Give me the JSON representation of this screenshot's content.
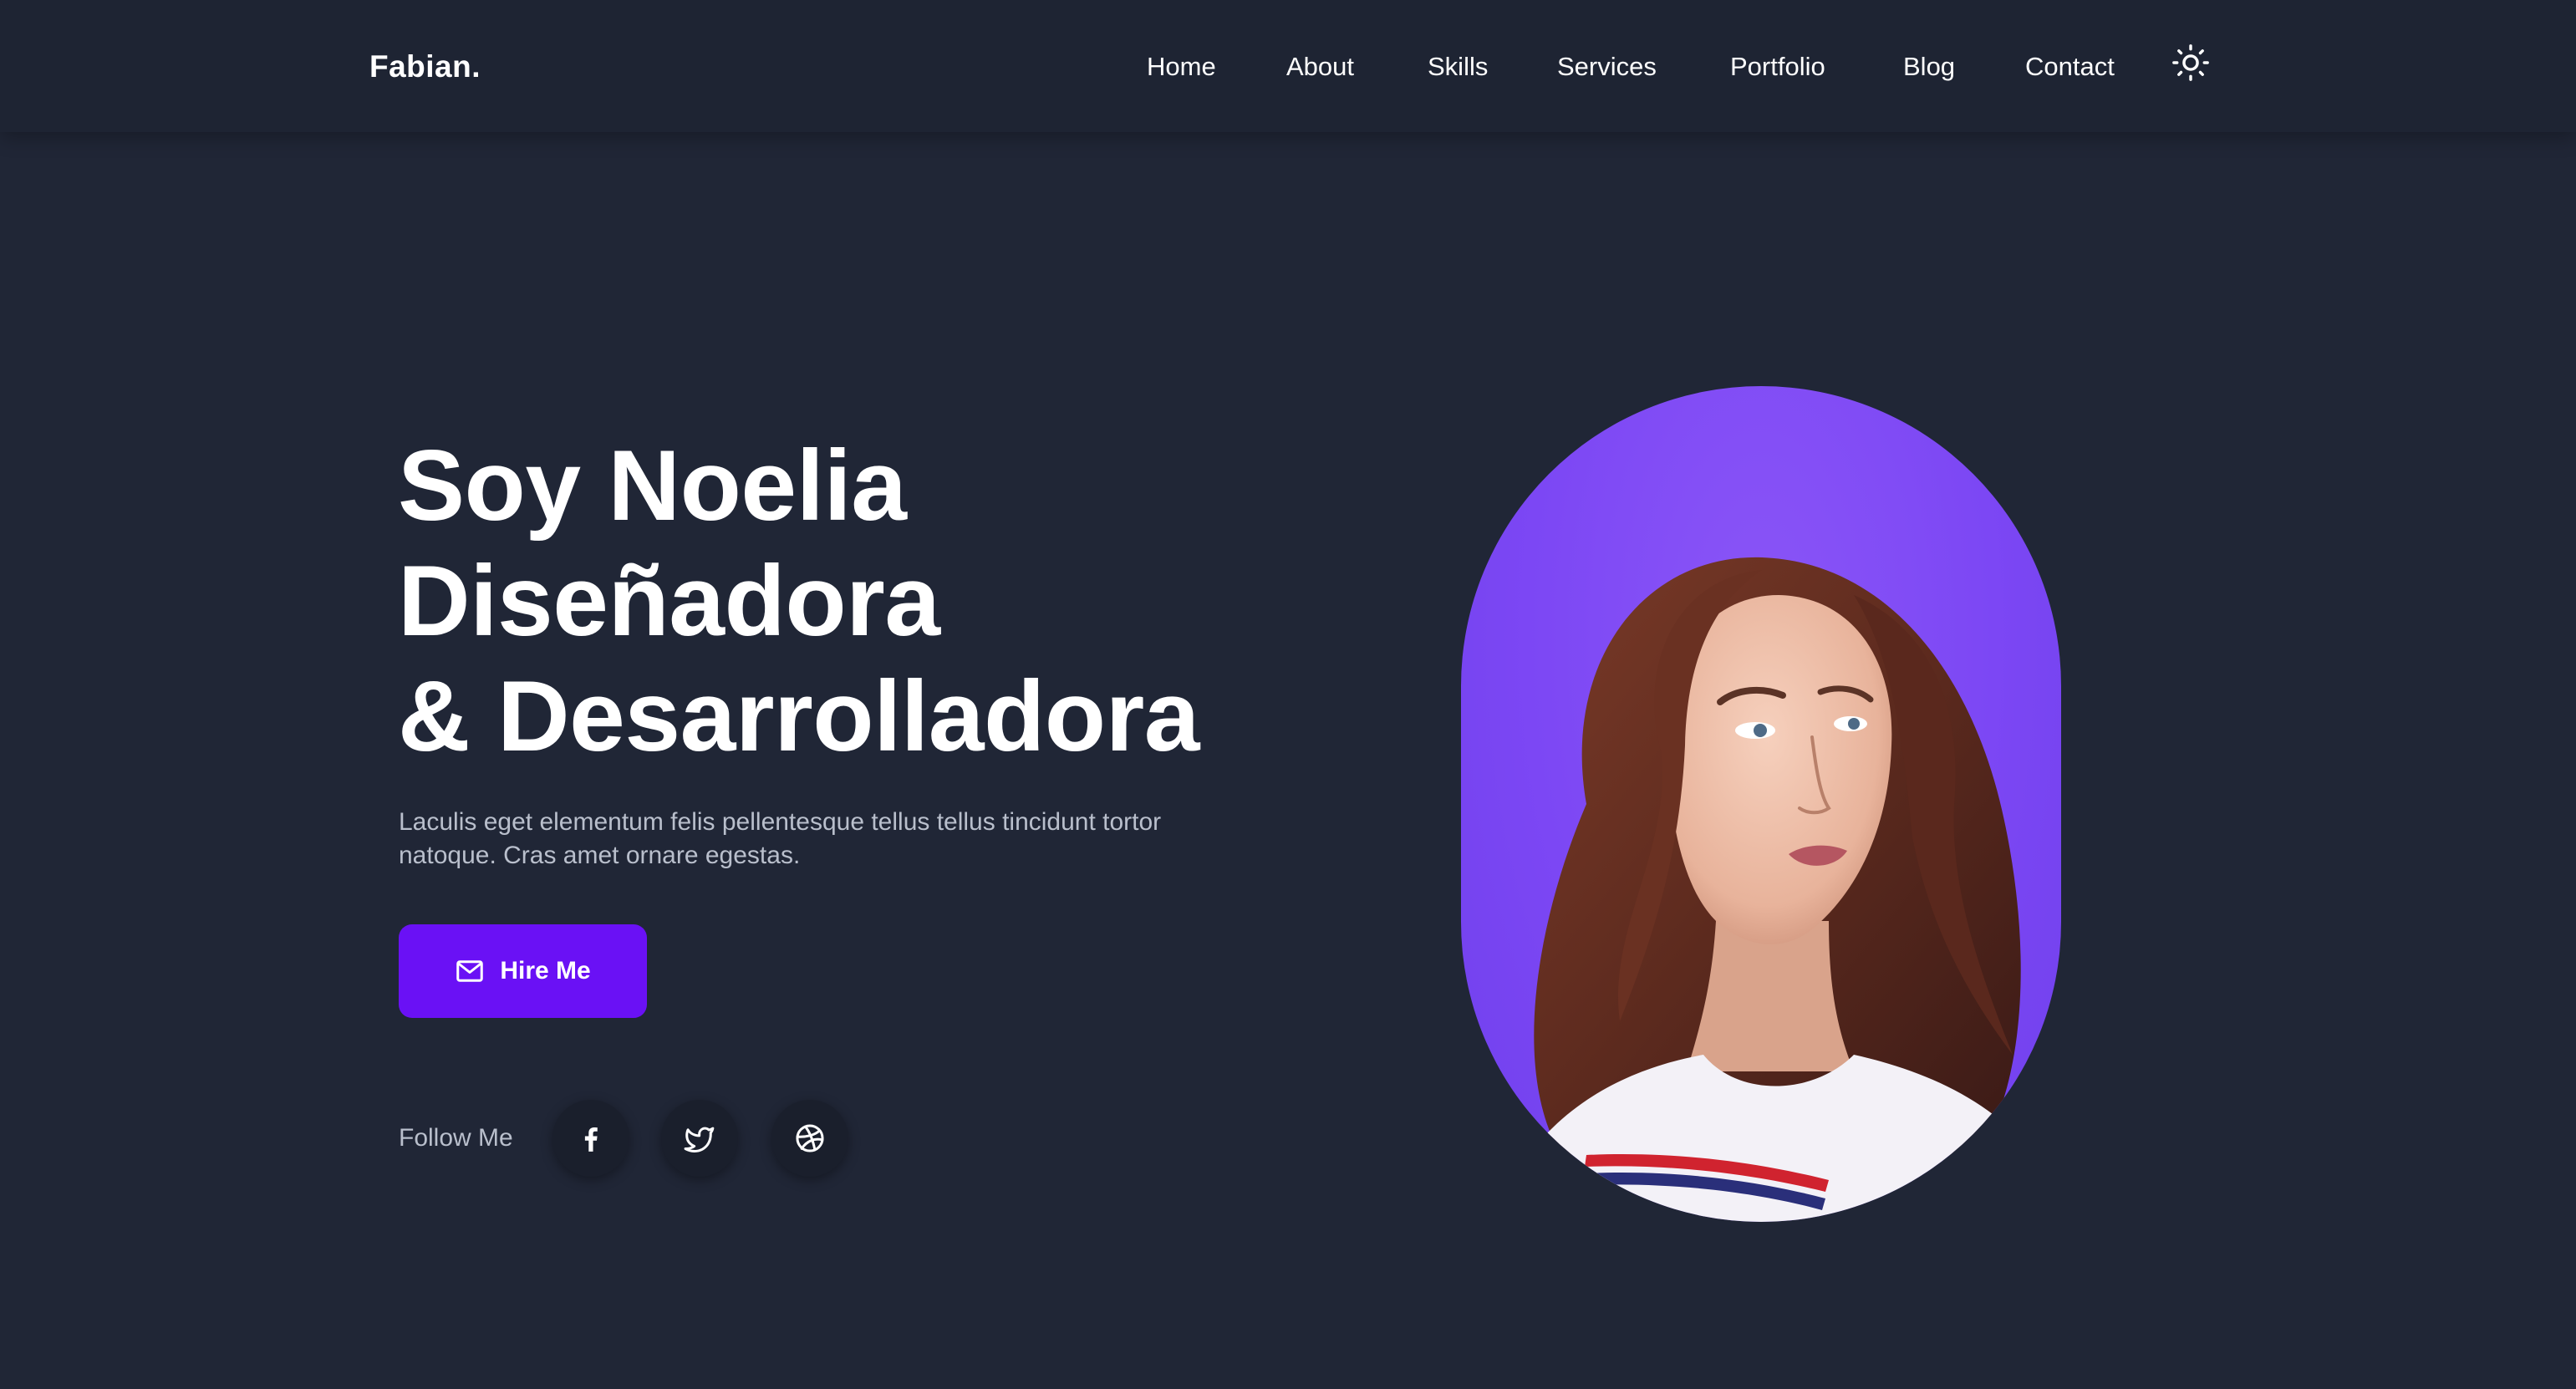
{
  "header": {
    "logo": "Fabian.",
    "nav": [
      "Home",
      "About",
      "Skills",
      "Services",
      "Portfolio",
      "Blog",
      "Contact"
    ],
    "theme_toggle_icon": "sun-icon"
  },
  "hero": {
    "title_line1": "Soy Noelia",
    "title_line2": "Diseñadora",
    "title_line3": "& Desarrolladora",
    "description": "Laculis eget elementum felis pellentesque tellus tellus tincidunt tortor natoque. Cras amet ornare egestas.",
    "hire_button": "Hire Me",
    "hire_button_icon": "mail-icon",
    "follow_label": "Follow Me",
    "socials": [
      "facebook-icon",
      "twitter-icon",
      "dribbble-icon"
    ],
    "portrait_icon": "profile-photo"
  },
  "colors": {
    "background": "#202636",
    "header": "#1e2433",
    "accent": "#6a11f5",
    "portrait_bg": "#7c47f4",
    "muted_text": "#b9bfcc"
  }
}
